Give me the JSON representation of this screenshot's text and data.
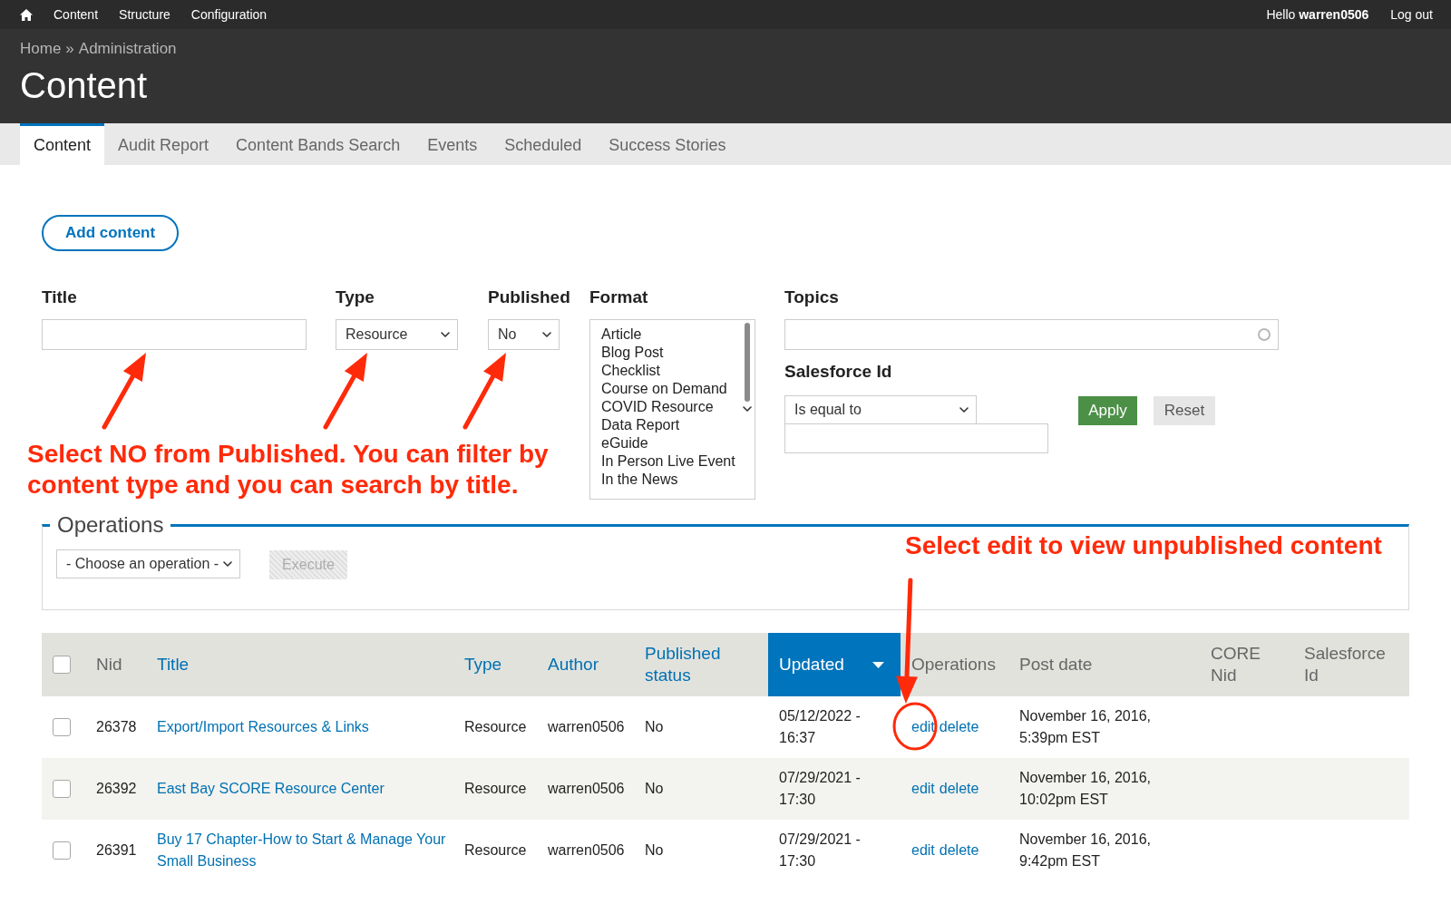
{
  "toolbar": {
    "links": [
      {
        "label": "Content"
      },
      {
        "label": "Structure"
      },
      {
        "label": "Configuration"
      }
    ],
    "greeting": "Hello **warren0506**",
    "logout": "Log out"
  },
  "header": {
    "breadcrumb": [
      {
        "label": "Home"
      },
      {
        "label": "Administration"
      }
    ],
    "separator": "»",
    "title": "Content"
  },
  "tabs": [
    {
      "label": "Content",
      "selected": true
    },
    {
      "label": "Audit Report",
      "selected": false
    },
    {
      "label": "Content Bands Search",
      "selected": false
    },
    {
      "label": "Events",
      "selected": false
    },
    {
      "label": "Scheduled",
      "selected": false
    },
    {
      "label": "Success Stories",
      "selected": false
    }
  ],
  "add_content": "Add content",
  "filters": {
    "title": {
      "label": "Title"
    },
    "type": {
      "label": "Type",
      "value": "Resource"
    },
    "published": {
      "label": "Published",
      "value": "No"
    },
    "format": {
      "label": "Format",
      "options": [
        {
          "label": "Article",
          "selected": false
        },
        {
          "label": "Blog Post",
          "selected": false
        },
        {
          "label": "Checklist",
          "selected": false
        },
        {
          "label": "Course on Demand",
          "selected": false
        },
        {
          "label": "COVID Resource",
          "selected": false
        },
        {
          "label": "Data Report",
          "selected": false
        },
        {
          "label": "eGuide",
          "selected": false
        },
        {
          "label": "In Person Live Event",
          "selected": false
        },
        {
          "label": "In the News",
          "selected": false
        }
      ]
    },
    "topics": {
      "label": "Topics"
    },
    "salesforce_id": {
      "label": "Salesforce Id",
      "operator": "Is equal to"
    },
    "apply": "Apply",
    "reset": "Reset"
  },
  "annotations": [
    {
      "text": "Select NO from Published. You can filter by content type and you can search by title."
    },
    {
      "text": "Select edit to view unpublished content"
    }
  ],
  "operations": {
    "legend": "Operations",
    "operation": "- Choose an operation -",
    "execute": {
      "label": "Execute",
      "disabled": true
    }
  },
  "table": {
    "select_all": {
      "checked": false
    },
    "columns": [
      {
        "label": "Nid",
        "sortable": false,
        "sorted": false
      },
      {
        "label": "Title",
        "sortable": true,
        "sorted": false
      },
      {
        "label": "Type",
        "sortable": true,
        "sorted": false
      },
      {
        "label": "Author",
        "sortable": true,
        "sorted": false
      },
      {
        "label": "Published status",
        "sortable": true,
        "sorted": false
      },
      {
        "label": "Updated",
        "sortable": true,
        "sorted": true
      },
      {
        "label": "Operations",
        "sortable": false,
        "sorted": false
      },
      {
        "label": "Post date",
        "sortable": false,
        "sorted": false
      },
      {
        "label": "CORE Nid",
        "sortable": false,
        "sorted": false
      },
      {
        "label": "Salesforce Id",
        "sortable": false,
        "sorted": false
      }
    ],
    "rows": [
      {
        "checked": false,
        "nid": "26378",
        "title": "Export/Import Resources & Links",
        "type": "Resource",
        "author": "warren0506",
        "published": "No",
        "updated": "05/12/2022 - 16:37",
        "operations": [
          "edit",
          "delete"
        ],
        "post_date": "November 16, 2016, 5:39pm EST"
      },
      {
        "checked": false,
        "nid": "26392",
        "title": "East Bay SCORE Resource Center",
        "type": "Resource",
        "author": "warren0506",
        "published": "No",
        "updated": "07/29/2021 - 17:30",
        "operations": [
          "edit",
          "delete"
        ],
        "post_date": "November 16, 2016, 10:02pm EST"
      },
      {
        "checked": false,
        "nid": "26391",
        "title": "Buy 17 Chapter-How to Start & Manage Your Small Business",
        "type": "Resource",
        "author": "warren0506",
        "published": "No",
        "updated": "07/29/2021 - 17:30",
        "operations": [
          "edit",
          "delete"
        ],
        "post_date": "November 16, 2016, 9:42pm EST"
      }
    ]
  }
}
